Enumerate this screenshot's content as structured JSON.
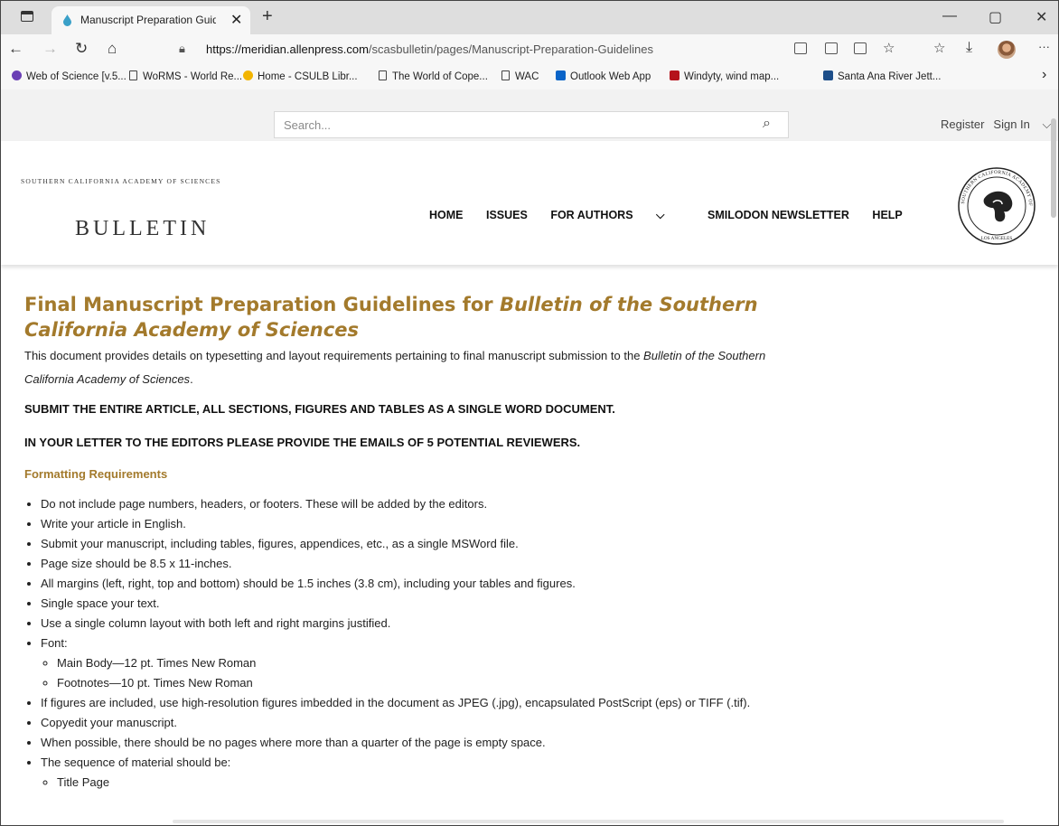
{
  "browser": {
    "tab_title": "Manuscript Preparation Guidelin",
    "tab_close": "✕",
    "new_tab": "+",
    "window": {
      "minimize": "—",
      "maximize": "▢",
      "close": "✕"
    },
    "nav": {
      "back": "←",
      "forward": "→",
      "reload": "↻",
      "home": "⌂"
    },
    "url_host": "https://meridian.allenpress.com",
    "url_path": "/scasbulletin/pages/Manuscript-Preparation-Guidelines",
    "more_icon": "···",
    "favorites": [
      {
        "label": "Web of Science [v.5...",
        "icon": "wos-icon",
        "color": "#6a3fb5"
      },
      {
        "label": "WoRMS - World Re...",
        "icon": "page-icon"
      },
      {
        "label": "Home - CSULB Libr...",
        "icon": "csulb-icon",
        "color": "#f2b400"
      },
      {
        "label": "The World of Cope...",
        "icon": "page-icon"
      },
      {
        "label": "WAC",
        "icon": "page-icon"
      },
      {
        "label": "Outlook Web App",
        "icon": "outlook-icon",
        "color": "#0a64c8"
      },
      {
        "label": "Windyty, wind map...",
        "icon": "windy-icon",
        "color": "#b5121b"
      },
      {
        "label": "Santa Ana River Jett...",
        "icon": "santa-ana-icon",
        "color": "#1d4e89"
      }
    ],
    "favorites_more": "›"
  },
  "site": {
    "search_placeholder": "Search...",
    "register": "Register",
    "sign_in": "Sign In",
    "org_name": "SOUTHERN CALIFORNIA ACADEMY OF SCIENCES",
    "logo_text": "BULLETIN",
    "nav": [
      "HOME",
      "ISSUES",
      "FOR AUTHORS",
      "SMILODON NEWSLETTER",
      "HELP"
    ],
    "seal_top": "SOUTHERN CALIFORNIA ACADEMY OF SCIENCES",
    "seal_bottom": "LOS ANGELES"
  },
  "article": {
    "title_plain": "Final Manuscript Preparation Guidelines for ",
    "title_italic": "Bulletin of the Southern California Academy of Sciences",
    "intro_plain": "This document provides details on typesetting and layout requirements pertaining to final manuscript submission to the ",
    "intro_italic": "Bulletin of the Southern California Academy of Sciences",
    "intro_end": ".",
    "notice_1": "SUBMIT THE ENTIRE ARTICLE, ALL SECTIONS, FIGURES AND TABLES AS A SINGLE WORD DOCUMENT.",
    "notice_2": "IN YOUR LETTER TO THE EDITORS PLEASE PROVIDE THE EMAILS OF 5 POTENTIAL REVIEWERS.",
    "section_heading": "Formatting Requirements",
    "requirements": [
      "Do not include page numbers, headers, or footers. These will be added by the editors.",
      "Write your article in English.",
      "Submit your manuscript, including tables, figures, appendices, etc., as a single MSWord file.",
      "Page size should be 8.5 x 11-inches.",
      "All margins (left, right, top and bottom) should be 1.5 inches (3.8 cm), including your tables and figures.",
      "Single space your text.",
      "Use a single column layout with both left and right margins justified.",
      "Font:"
    ],
    "font_items": [
      "Main Body—12 pt. Times New Roman",
      "Footnotes—10 pt. Times New Roman"
    ],
    "requirements_2": [
      "If figures are included, use high-resolution figures imbedded in the document as JPEG (.jpg), encapsulated PostScript (eps) or TIFF (.tif).",
      "Copyedit your manuscript.",
      "When possible, there should be no pages where more than a quarter of the page is empty space.",
      "The sequence of material should be:"
    ],
    "sequence_items": [
      "Title Page"
    ]
  }
}
